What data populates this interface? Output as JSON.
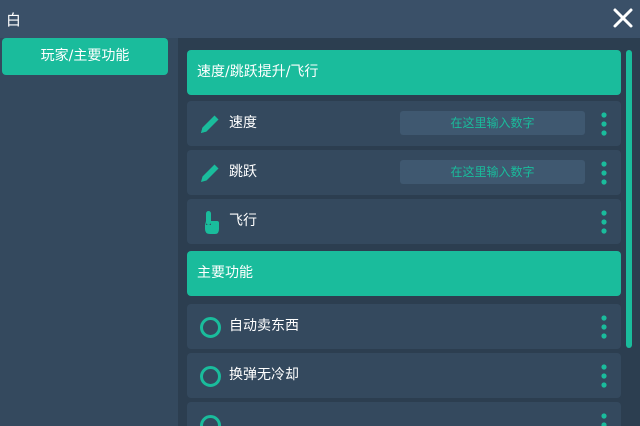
{
  "window": {
    "title": "白"
  },
  "colors": {
    "accent": "#1abc9c",
    "background": "#34495e",
    "panel": "#2c3e50"
  },
  "sidebar": {
    "items": [
      {
        "label": "玩家/主要功能"
      }
    ]
  },
  "sections": [
    {
      "header": "速度/跳跃提升/飞行",
      "rows": [
        {
          "label": "速度",
          "icon": "pencil-icon",
          "placeholder": "在这里输入数字"
        },
        {
          "label": "跳跃",
          "icon": "pencil-icon",
          "placeholder": "在这里输入数字"
        },
        {
          "label": "飞行",
          "icon": "tap-icon"
        }
      ]
    },
    {
      "header": "主要功能",
      "rows": [
        {
          "label": "自动卖东西",
          "icon": "circle-toggle-icon"
        },
        {
          "label": "换弹无冷却",
          "icon": "circle-toggle-icon"
        },
        {
          "label": "",
          "icon": "circle-toggle-icon"
        }
      ]
    }
  ]
}
